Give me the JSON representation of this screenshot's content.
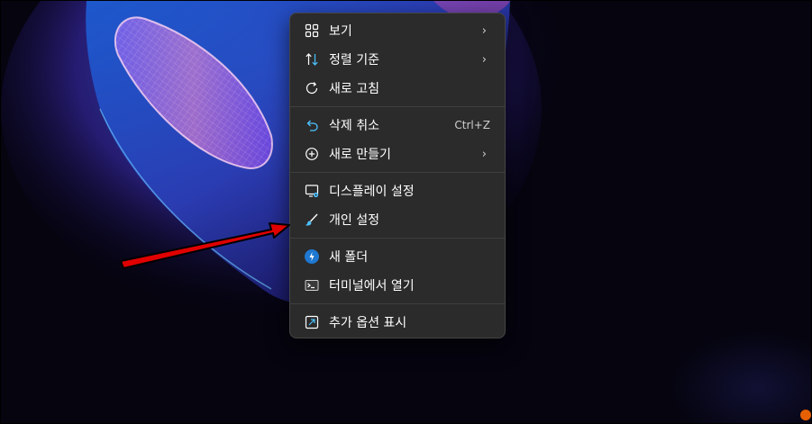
{
  "context_menu": {
    "items": [
      {
        "label": "보기",
        "icon": "grid-view-icon",
        "has_submenu": true
      },
      {
        "label": "정렬 기준",
        "icon": "sort-arrows-icon",
        "has_submenu": true
      },
      {
        "label": "새로 고침",
        "icon": "refresh-icon",
        "has_submenu": false
      },
      {
        "label": "삭제 취소",
        "icon": "undo-icon",
        "shortcut": "Ctrl+Z"
      },
      {
        "label": "새로 만들기",
        "icon": "add-circle-icon",
        "has_submenu": true
      },
      {
        "label": "디스플레이 설정",
        "icon": "display-settings-icon"
      },
      {
        "label": "개인 설정",
        "icon": "brush-icon"
      },
      {
        "label": "새 폴더",
        "icon": "new-folder-icon"
      },
      {
        "label": "터미널에서 열기",
        "icon": "terminal-icon"
      },
      {
        "label": "추가 옵션 표시",
        "icon": "show-more-options-icon"
      }
    ],
    "chevron_glyph": "›"
  },
  "colors": {
    "menu_background": "#2b2b2b",
    "menu_text": "#ffffff",
    "accent": "#4cc2ff",
    "annotation_arrow": "#e00000"
  }
}
